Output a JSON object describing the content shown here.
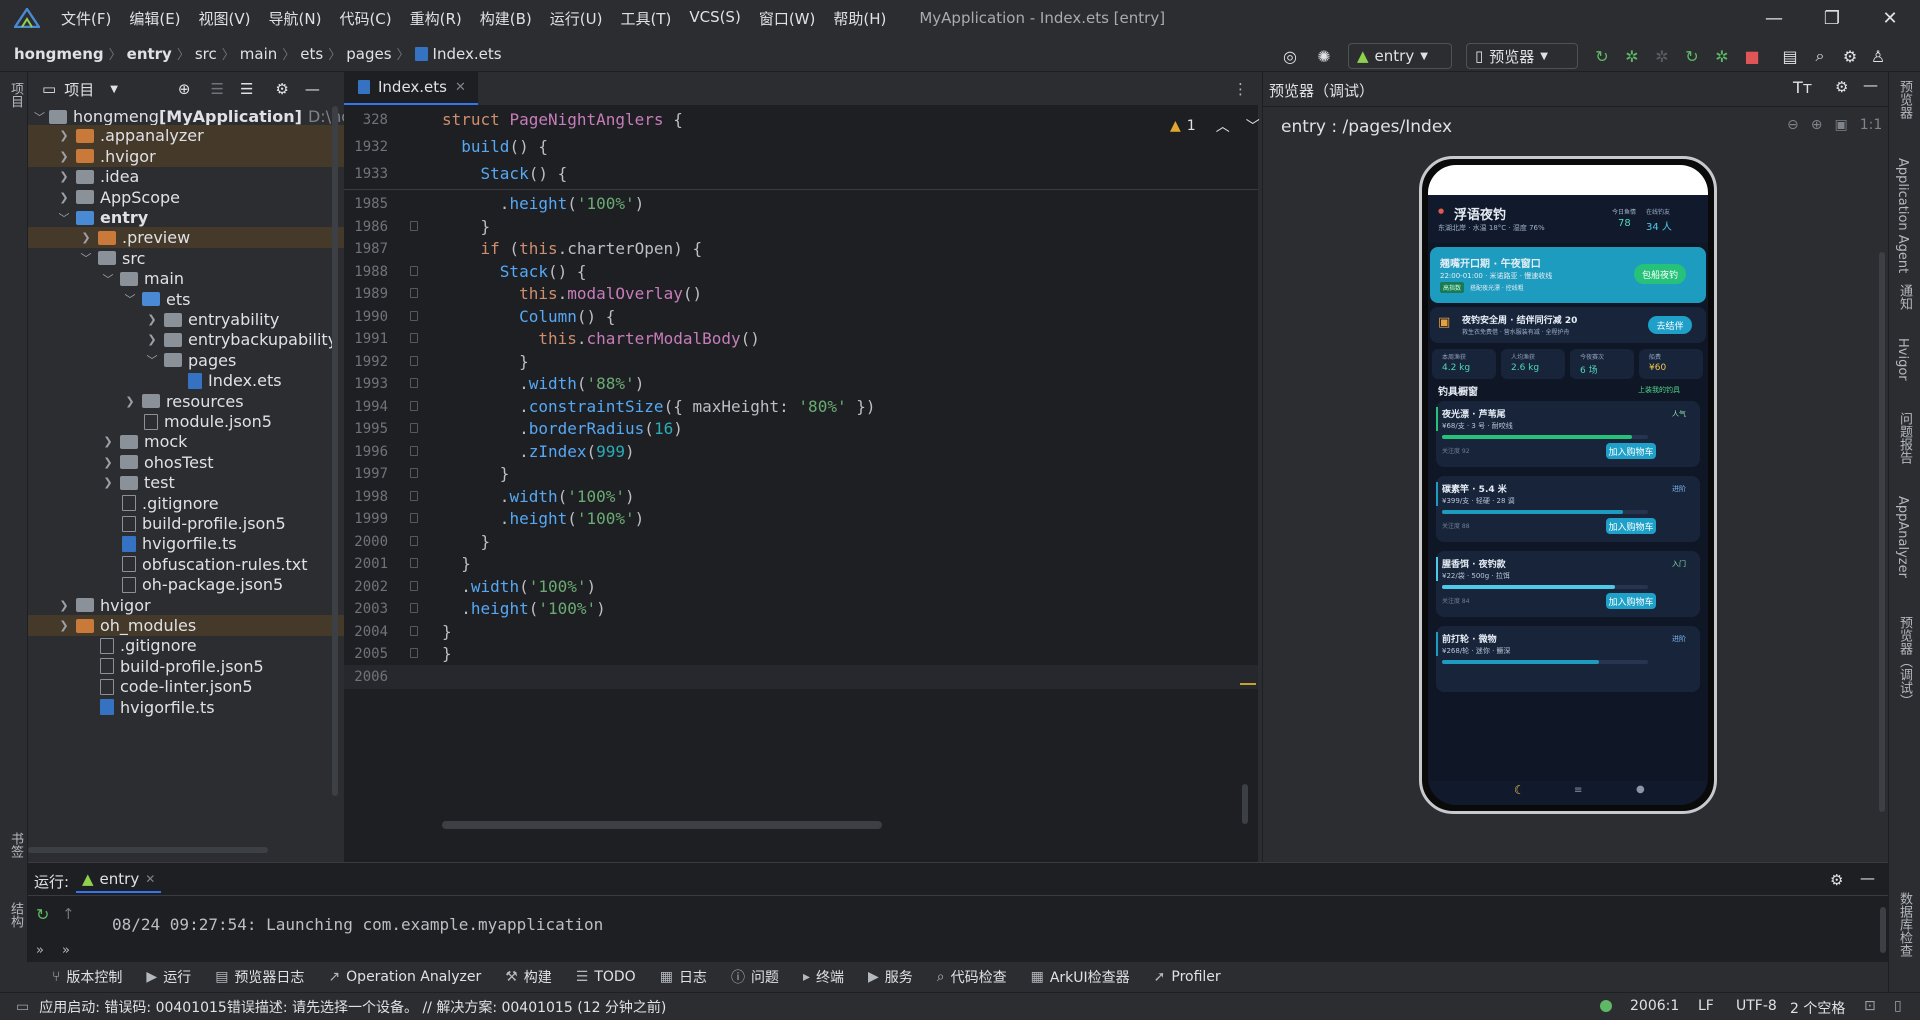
{
  "app": {
    "title": "MyApplication - Index.ets [entry]"
  },
  "menu": [
    "文件(F)",
    "编辑(E)",
    "视图(V)",
    "导航(N)",
    "代码(C)",
    "重构(R)",
    "构建(B)",
    "运行(U)",
    "工具(T)",
    "VCS(S)",
    "窗口(W)",
    "帮助(H)"
  ],
  "breadcrumb": [
    "hongmeng",
    "entry",
    "src",
    "main",
    "ets",
    "pages",
    "Index.ets"
  ],
  "toolbar": {
    "run_config": "entry",
    "previewer": "预览器"
  },
  "project": {
    "title": "项目",
    "root": "hongmeng",
    "root_module": "[MyApplication]",
    "root_path": "D:\\hon",
    "items": [
      ".appanalyzer",
      ".hvigor",
      ".idea",
      "AppScope",
      "entry",
      ".preview",
      "src",
      "main",
      "ets",
      "entryability",
      "entrybackupability",
      "pages",
      "Index.ets",
      "resources",
      "module.json5",
      "mock",
      "ohosTest",
      "test",
      ".gitignore",
      "build-profile.json5",
      "hvigorfile.ts",
      "obfuscation-rules.txt",
      "oh-package.json5",
      "hvigor",
      "oh_modules",
      ".gitignore",
      "build-profile.json5",
      "code-linter.json5",
      "hvigorfile.ts"
    ]
  },
  "editor": {
    "tab": "Index.ets",
    "warnings": "1",
    "sticky_lines": [
      "328",
      "1932",
      "1933"
    ],
    "lines": [
      "1985",
      "1986",
      "1987",
      "1988",
      "1989",
      "1990",
      "1991",
      "1992",
      "1993",
      "1994",
      "1995",
      "1996",
      "1997",
      "1998",
      "1999",
      "2000",
      "2001",
      "2002",
      "2003",
      "2004",
      "2005",
      "2006"
    ]
  },
  "previewer": {
    "title": "预览器（调试）",
    "route": "entry : /pages/Index",
    "zoom_label": "1:1",
    "app": {
      "name": "浮语夜钓",
      "sub": "东湖北岸 · 水温 18°C · 湿度 76%",
      "stat1_label": "今日鱼情",
      "stat1_value": "78",
      "stat2_label": "在线钓友",
      "stat2_value": "34 人",
      "banner_title": "翘嘴开口期 · 午夜窗口",
      "banner_sub": "22:00-01:00 · 米诺路亚 · 慢速收线",
      "banner_tag1": "高指数",
      "banner_tag2": "搭配夜光漂 · 控线粗",
      "banner_btn": "包船夜钓",
      "safety_title": "夜钓安全周 · 结伴同行减 20",
      "safety_sub": "救生衣免费借 · 营水服装有减 · 全程护舟",
      "safety_btn": "去结伴",
      "stats": [
        {
          "label": "本周渔获",
          "value": "4.2 kg"
        },
        {
          "label": "人均渔获",
          "value": "2.6 kg"
        },
        {
          "label": "今夜赛次",
          "value": "6 场"
        },
        {
          "label": "船费",
          "value": "¥60"
        }
      ],
      "shop_title": "钓具橱窗",
      "shop_link": "上装我的钓具",
      "products": [
        {
          "name": "夜光漂 · 芦苇尾",
          "tag": "人气",
          "meta": "¥68/支 · 3 号 · 耐咬线",
          "sold": "关注度 92",
          "btn": "加入购物车",
          "progress": 0.92
        },
        {
          "name": "碳素竿 · 5.4 米",
          "tag": "进阶",
          "meta": "¥399/支 · 轻硬 · 28 调",
          "sold": "关注度 88",
          "btn": "加入购物车",
          "progress": 0.88
        },
        {
          "name": "腥香饵 · 夜钓款",
          "tag": "入门",
          "meta": "¥22/袋 · 500g · 拉饵",
          "sold": "关注度 84",
          "btn": "加入购物车",
          "progress": 0.84
        },
        {
          "name": "前打轮 · 微物",
          "tag": "进阶",
          "meta": "¥268/轮 · 迷你 · 鳜深",
          "sold": "",
          "btn": "",
          "progress": 0.76
        }
      ]
    }
  },
  "run": {
    "label": "运行:",
    "config": "entry",
    "log": "08/24 09:27:54: Launching com.example.myapplication"
  },
  "tools": [
    "版本控制",
    "运行",
    "预览器日志",
    "Operation Analyzer",
    "构建",
    "TODO",
    "日志",
    "问题",
    "终端",
    "服务",
    "代码检查",
    "ArkUI检查器",
    "Profiler"
  ],
  "status": {
    "message": "应用启动: 错误码: 00401015错误描述: 请先选择一个设备。 // 解决方案: 00401015 (12 分钟之前)",
    "position": "2006:1",
    "line_sep": "LF",
    "encoding": "UTF-8",
    "indent": "2 个空格"
  },
  "left_strip": [
    "项目",
    "书签",
    "结构"
  ],
  "right_strip": [
    "预览器",
    "Application Agent",
    "通知",
    "Hvigor",
    "问题报告",
    "AppAnalyzer",
    "预览器（调试）",
    "数据库检查"
  ]
}
